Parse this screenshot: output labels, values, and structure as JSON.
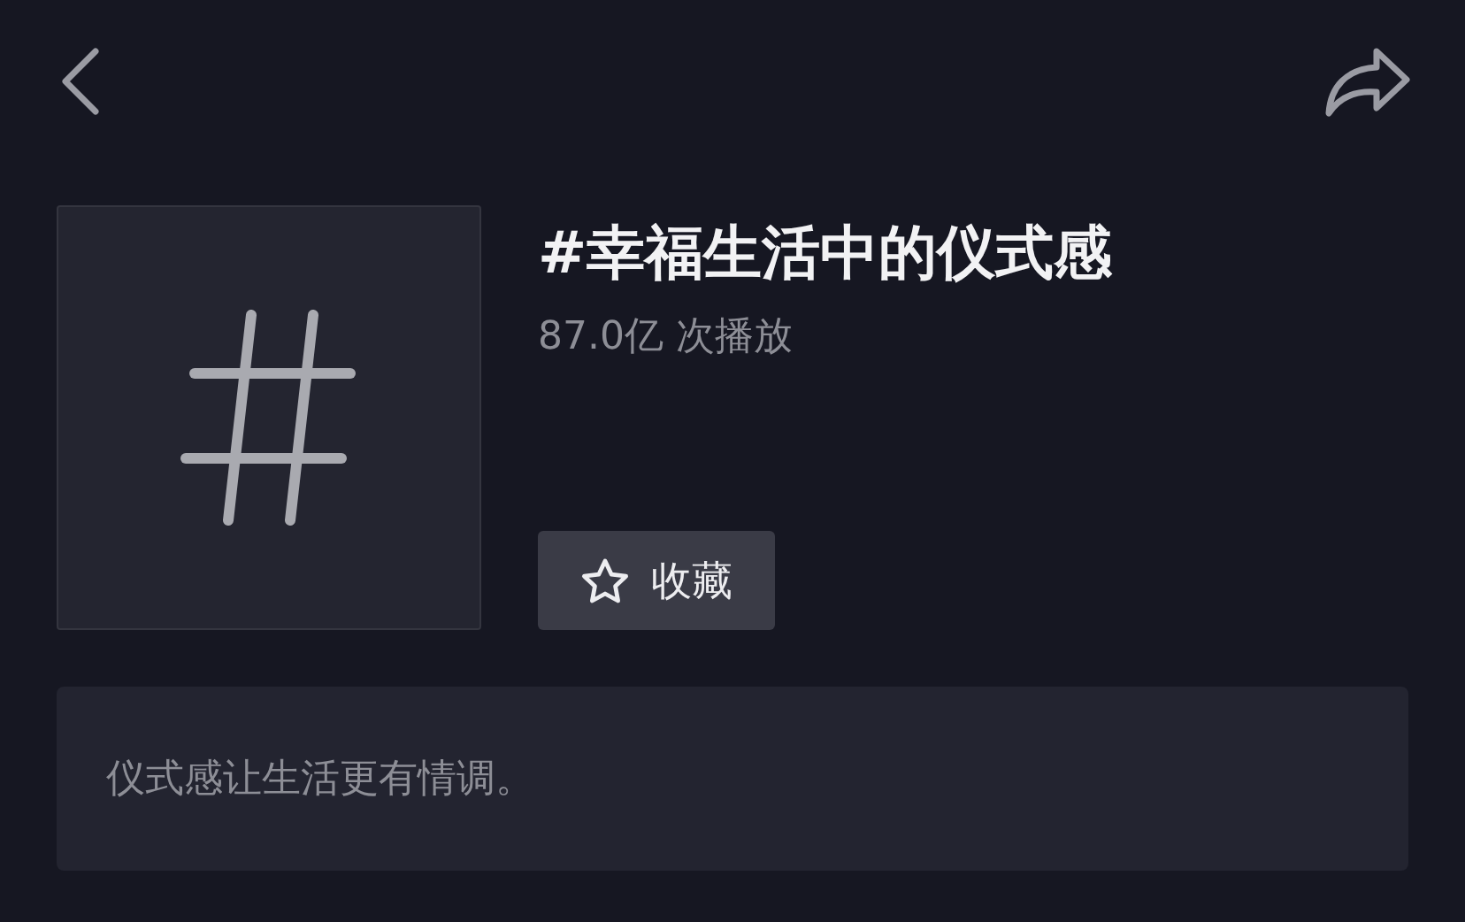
{
  "topic": {
    "title": "#幸福生活中的仪式感",
    "views": "87.0亿 次播放"
  },
  "favorite_button": {
    "label": "收藏"
  },
  "description": "仪式感让生活更有情调。"
}
